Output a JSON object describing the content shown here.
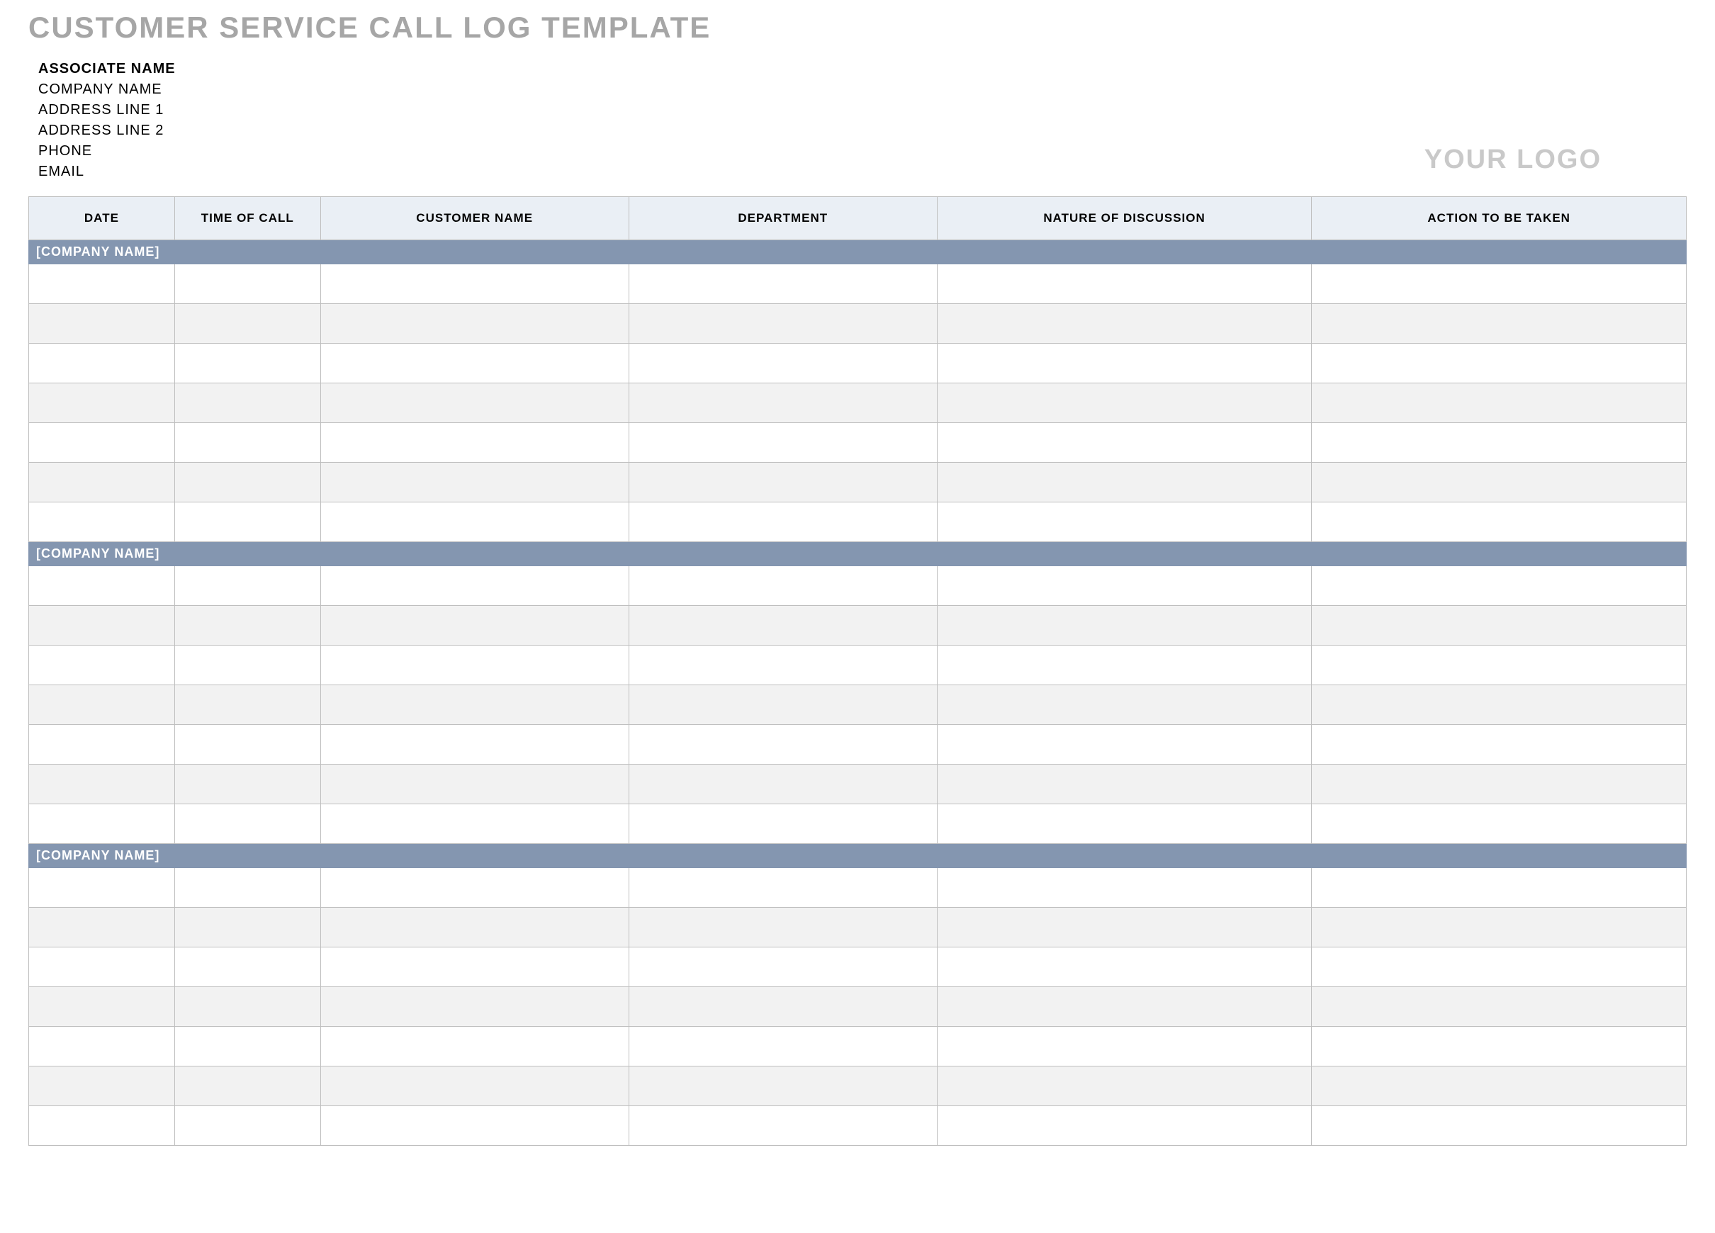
{
  "title": "CUSTOMER SERVICE CALL LOG TEMPLATE",
  "info": {
    "associate": "ASSOCIATE NAME",
    "company": "COMPANY NAME",
    "addr1": "ADDRESS LINE 1",
    "addr2": "ADDRESS LINE 2",
    "phone": "PHONE",
    "email": "EMAIL"
  },
  "logo_text": "YOUR LOGO",
  "columns": {
    "date": "DATE",
    "time": "TIME OF CALL",
    "customer": "CUSTOMER NAME",
    "department": "DEPARTMENT",
    "nature": "NATURE OF DISCUSSION",
    "action": "ACTION TO BE TAKEN"
  },
  "sections": [
    {
      "label": "[COMPANY NAME]",
      "rows": 7
    },
    {
      "label": "[COMPANY NAME]",
      "rows": 7
    },
    {
      "label": "[COMPANY NAME]",
      "rows": 7
    }
  ]
}
